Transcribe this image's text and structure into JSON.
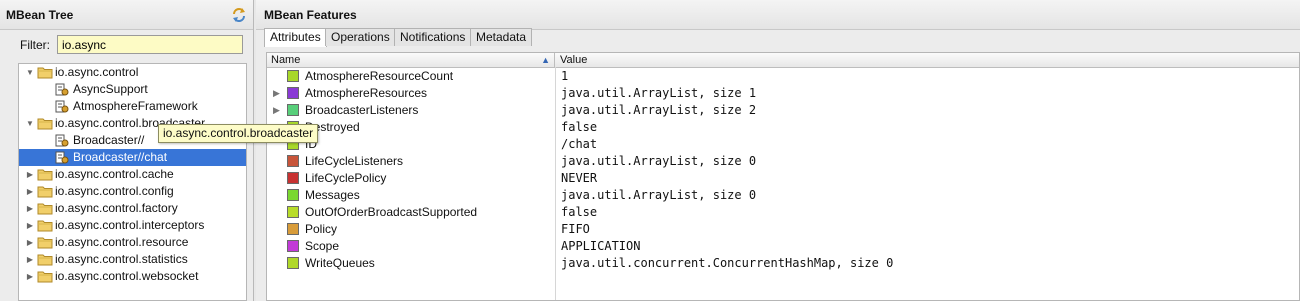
{
  "left_panel": {
    "title": "MBean Tree",
    "filter_label": "Filter:",
    "filter_value": "io.async",
    "tooltip": "io.async.control.broadcaster",
    "tree": [
      {
        "label": "io.async.control",
        "type": "folder",
        "expanded": true,
        "depth": 0
      },
      {
        "label": "AsyncSupport",
        "type": "bean",
        "depth": 1
      },
      {
        "label": "AtmosphereFramework",
        "type": "bean",
        "depth": 1
      },
      {
        "label": "io.async.control.broadcaster",
        "type": "folder",
        "expanded": true,
        "depth": 0
      },
      {
        "label": "Broadcaster//",
        "type": "bean",
        "depth": 1
      },
      {
        "label": "Broadcaster//chat",
        "type": "bean",
        "depth": 1,
        "selected": true
      },
      {
        "label": "io.async.control.cache",
        "type": "folder",
        "expanded": false,
        "depth": 0
      },
      {
        "label": "io.async.control.config",
        "type": "folder",
        "expanded": false,
        "depth": 0
      },
      {
        "label": "io.async.control.factory",
        "type": "folder",
        "expanded": false,
        "depth": 0
      },
      {
        "label": "io.async.control.interceptors",
        "type": "folder",
        "expanded": false,
        "depth": 0
      },
      {
        "label": "io.async.control.resource",
        "type": "folder",
        "expanded": false,
        "depth": 0
      },
      {
        "label": "io.async.control.statistics",
        "type": "folder",
        "expanded": false,
        "depth": 0
      },
      {
        "label": "io.async.control.websocket",
        "type": "folder",
        "expanded": false,
        "depth": 0
      }
    ]
  },
  "right_panel": {
    "title": "MBean Features",
    "tabs": [
      "Attributes",
      "Operations",
      "Notifications",
      "Metadata"
    ],
    "active_tab": "Attributes",
    "columns": [
      "Name",
      "Value"
    ],
    "rows": [
      {
        "name": "AtmosphereResourceCount",
        "value": "1",
        "color": "#a8d82a",
        "expandable": false
      },
      {
        "name": "AtmosphereResources",
        "value": "java.util.ArrayList, size 1",
        "color": "#8a3ad6",
        "expandable": true
      },
      {
        "name": "BroadcasterListeners",
        "value": "java.util.ArrayList, size 2",
        "color": "#58cf7a",
        "expandable": true
      },
      {
        "name": "Destroyed",
        "value": "false",
        "color": "#a8d82a",
        "expandable": false
      },
      {
        "name": "ID",
        "value": "/chat",
        "color": "#a8d82a",
        "expandable": false
      },
      {
        "name": "LifeCycleListeners",
        "value": "java.util.ArrayList, size 0",
        "color": "#c8553a",
        "expandable": false
      },
      {
        "name": "LifeCyclePolicy",
        "value": "NEVER",
        "color": "#c83232",
        "expandable": false
      },
      {
        "name": "Messages",
        "value": "java.util.ArrayList, size 0",
        "color": "#7ad830",
        "expandable": false
      },
      {
        "name": "OutOfOrderBroadcastSupported",
        "value": "false",
        "color": "#b8dc2a",
        "expandable": false
      },
      {
        "name": "Policy",
        "value": "FIFO",
        "color": "#d89c3a",
        "expandable": false
      },
      {
        "name": "Scope",
        "value": "APPLICATION",
        "color": "#c23ad8",
        "expandable": false
      },
      {
        "name": "WriteQueues",
        "value": "java.util.concurrent.ConcurrentHashMap, size 0",
        "color": "#b0d82a",
        "expandable": false
      }
    ]
  }
}
